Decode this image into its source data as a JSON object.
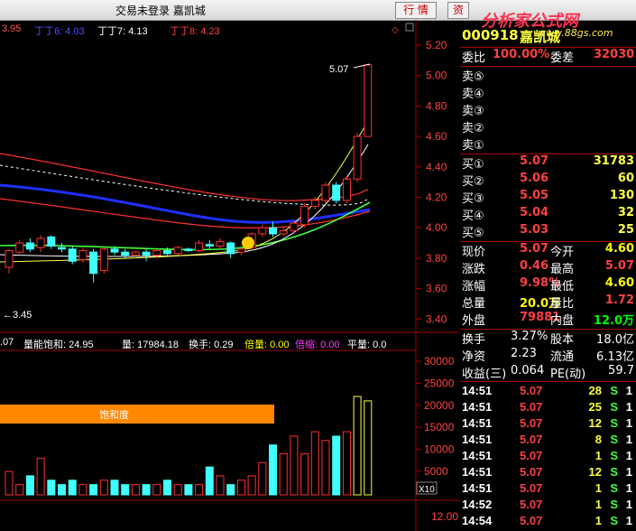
{
  "window": {
    "title": "交易未登录  嘉凯城"
  },
  "toolbar": {
    "quote_btn": "行 情",
    "trade_btn": "资"
  },
  "watermark": {
    "text": "分析家公式网",
    "url": "www.88gs.com"
  },
  "ma_legend": [
    {
      "label": "3.95",
      "color": "#ff5555"
    },
    {
      "label": "丁丁6: 4.03",
      "color": "#5050ff"
    },
    {
      "label": "丁丁7: 4.13",
      "color": "#ffffff"
    },
    {
      "label": "丁丁8: 4.23",
      "color": "#ff4040"
    }
  ],
  "price_axis": [
    "5.20",
    "5.00",
    "4.80",
    "4.60",
    "4.40",
    "4.20",
    "4.00",
    "3.80",
    "3.60",
    "3.40"
  ],
  "price_marks": {
    "high": "5.07",
    "low": "←3.45"
  },
  "volume_axis": [
    "30000",
    "25000",
    "20000",
    "15000",
    "10000",
    "5000"
  ],
  "volume_unit": "X10",
  "bottom_axis": "12.00",
  "vol_indicators": [
    {
      "label": ".07",
      "color": "#ffffff"
    },
    {
      "label": "量能饱和: 24.95",
      "color": "#ffffff"
    },
    {
      "label": "量: 17984.18",
      "color": "#ffffff"
    },
    {
      "label": "换手: 0.29",
      "color": "#ffffff"
    },
    {
      "label": "倍量: 0.00",
      "color": "#ffff00"
    },
    {
      "label": "倍缩: 0.00",
      "color": "#ff40ff"
    },
    {
      "label": "平量: 0.0",
      "color": "#ffffff"
    }
  ],
  "saturation_label": "饱和度",
  "stock": {
    "code": "000918",
    "name": "嘉凯城"
  },
  "order_book": {
    "ratio_label": "委比",
    "ratio_value": "100.00%",
    "diff_label": "委差",
    "diff_value": "32030",
    "sells": [
      "卖⑤",
      "卖④",
      "卖③",
      "卖②",
      "卖①"
    ],
    "buys": [
      {
        "label": "买①",
        "price": "5.07",
        "vol": "31783"
      },
      {
        "label": "买②",
        "price": "5.06",
        "vol": "60"
      },
      {
        "label": "买③",
        "price": "5.05",
        "vol": "130"
      },
      {
        "label": "买④",
        "price": "5.04",
        "vol": "32"
      },
      {
        "label": "买⑤",
        "price": "5.03",
        "vol": "25"
      }
    ]
  },
  "stats": [
    {
      "l1": "现价",
      "v1": "5.07",
      "c1": "#ff4040",
      "l2": "今开",
      "v2": "4.60",
      "c2": "#ffff00"
    },
    {
      "l1": "涨跌",
      "v1": "0.46",
      "c1": "#ff4040",
      "l2": "最高",
      "v2": "5.07",
      "c2": "#ff4040"
    },
    {
      "l1": "涨幅",
      "v1": "9.98%",
      "c1": "#ff4040",
      "l2": "最低",
      "v2": "4.60",
      "c2": "#ffff00"
    },
    {
      "l1": "总量",
      "v1": "20.0万",
      "c1": "#ffff00",
      "l2": "量比",
      "v2": "1.72",
      "c2": "#ff4040"
    },
    {
      "l1": "外盘",
      "v1": "79881",
      "c1": "#ff4040",
      "l2": "内盘",
      "v2": "12.0万",
      "c2": "#00ff00"
    }
  ],
  "stats2": [
    {
      "l1": "换手",
      "v1": "3.27%",
      "l2": "股本",
      "v2": "18.0亿"
    },
    {
      "l1": "净资",
      "v1": "2.23",
      "l2": "流通",
      "v2": "6.13亿"
    },
    {
      "l1": "收益(三)",
      "v1": "0.064",
      "l2": "PE(动)",
      "v2": "59.7"
    }
  ],
  "ticks": [
    {
      "time": "14:51",
      "price": "5.07",
      "vol": "28",
      "side": "S",
      "n": "1"
    },
    {
      "time": "14:51",
      "price": "5.07",
      "vol": "25",
      "side": "S",
      "n": "1"
    },
    {
      "time": "14:51",
      "price": "5.07",
      "vol": "12",
      "side": "S",
      "n": "1"
    },
    {
      "time": "14:51",
      "price": "5.07",
      "vol": "8",
      "side": "S",
      "n": "1"
    },
    {
      "time": "14:51",
      "price": "5.07",
      "vol": "1",
      "side": "S",
      "n": "1"
    },
    {
      "time": "14:51",
      "price": "5.07",
      "vol": "12",
      "side": "S",
      "n": "1"
    },
    {
      "time": "14:51",
      "price": "5.07",
      "vol": "1",
      "side": "S",
      "n": "1"
    },
    {
      "time": "14:52",
      "price": "5.07",
      "vol": "1",
      "side": "S",
      "n": "1"
    },
    {
      "time": "14:54",
      "price": "5.07",
      "vol": "1",
      "side": "S",
      "n": "1"
    }
  ],
  "candles": [
    [
      3.74,
      3.85,
      3.7,
      3.86
    ],
    [
      3.84,
      3.9,
      3.82,
      3.92
    ],
    [
      3.9,
      3.86,
      3.84,
      3.93
    ],
    [
      3.87,
      3.93,
      3.84,
      3.95
    ],
    [
      3.94,
      3.88,
      3.86,
      3.95
    ],
    [
      3.87,
      3.86,
      3.84,
      3.9
    ],
    [
      3.86,
      3.78,
      3.76,
      3.88
    ],
    [
      3.79,
      3.85,
      3.77,
      3.87
    ],
    [
      3.84,
      3.7,
      3.64,
      3.86
    ],
    [
      3.72,
      3.86,
      3.7,
      3.87
    ],
    [
      3.86,
      3.84,
      3.82,
      3.88
    ],
    [
      3.84,
      3.82,
      3.8,
      3.86
    ],
    [
      3.82,
      3.84,
      3.8,
      3.85
    ],
    [
      3.84,
      3.82,
      3.78,
      3.86
    ],
    [
      3.82,
      3.85,
      3.8,
      3.86
    ],
    [
      3.85,
      3.83,
      3.82,
      3.87
    ],
    [
      3.83,
      3.87,
      3.82,
      3.88
    ],
    [
      3.86,
      3.85,
      3.84,
      3.87
    ],
    [
      3.85,
      3.9,
      3.84,
      3.92
    ],
    [
      3.89,
      3.88,
      3.86,
      3.92
    ],
    [
      3.88,
      3.91,
      3.86,
      3.93
    ],
    [
      3.9,
      3.83,
      3.8,
      3.91
    ],
    [
      3.84,
      3.86,
      3.82,
      3.88
    ],
    [
      3.87,
      3.96,
      3.85,
      3.97
    ],
    [
      3.96,
      4.0,
      3.94,
      4.02
    ],
    [
      4.0,
      3.96,
      3.94,
      4.04
    ],
    [
      3.96,
      3.98,
      3.95,
      4.01
    ],
    [
      3.98,
      4.03,
      3.96,
      4.05
    ],
    [
      4.02,
      4.14,
      4.0,
      4.16
    ],
    [
      4.14,
      4.18,
      4.12,
      4.2
    ],
    [
      4.18,
      4.28,
      4.16,
      4.3
    ],
    [
      4.28,
      4.18,
      4.16,
      4.3
    ],
    [
      4.18,
      4.32,
      4.16,
      4.34
    ],
    [
      4.32,
      4.6,
      4.3,
      4.62
    ],
    [
      4.6,
      5.07,
      4.6,
      5.07
    ]
  ],
  "volumes": [
    5,
    2,
    4,
    8,
    3,
    2,
    3,
    2,
    2,
    3,
    3,
    2,
    2,
    2,
    2,
    3,
    2,
    2,
    2,
    6,
    4,
    2,
    3,
    4,
    7,
    11,
    9,
    13,
    9,
    14,
    12,
    13,
    14,
    22,
    21
  ]
}
